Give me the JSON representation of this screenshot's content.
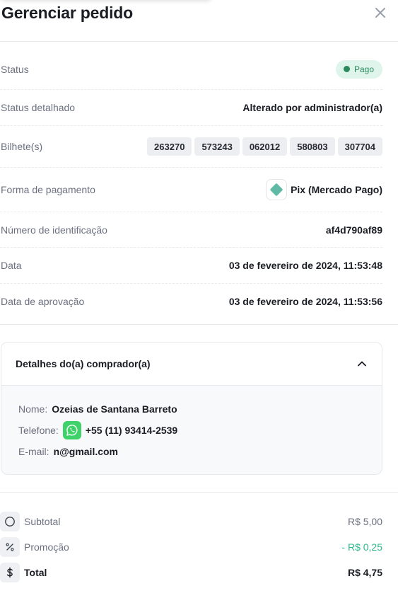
{
  "header": {
    "title": "Gerenciar pedido"
  },
  "details": {
    "status": {
      "label": "Status",
      "value": "Pago",
      "color": "#2a8a5e"
    },
    "status_detail": {
      "label": "Status detalhado",
      "value": "Alterado por administrador(a)"
    },
    "tickets": {
      "label": "Bilhete(s)",
      "items": [
        "263270",
        "573243",
        "062012",
        "580803",
        "307704"
      ]
    },
    "payment": {
      "label": "Forma de pagamento",
      "value": "Pix (Mercado Pago)",
      "icon": "pix-icon"
    },
    "id": {
      "label": "Número de identificação",
      "value": "af4d790af89"
    },
    "date": {
      "label": "Data",
      "value": "03 de fevereiro de 2024, 11:53:48"
    },
    "approval_date": {
      "label": "Data de aprovação",
      "value": "03 de fevereiro de 2024, 11:53:56"
    }
  },
  "buyer": {
    "title": "Detalhes do(a) comprador(a)",
    "name_label": "Nome:",
    "name": "Ozeias de Santana Barreto",
    "phone_label": "Telefone:",
    "phone": "+55 (11) 93414-2539",
    "email_label": "E-mail:",
    "email": "n@gmail.com"
  },
  "totals": {
    "subtotal": {
      "label": "Subtotal",
      "value": "R$ 5,00"
    },
    "promo": {
      "label": "Promoção",
      "value": "- R$ 0,25"
    },
    "total": {
      "label": "Total",
      "value": "R$ 4,75"
    }
  },
  "colors": {
    "accent_green": "#2eb88a",
    "whatsapp": "#3fd16a"
  }
}
